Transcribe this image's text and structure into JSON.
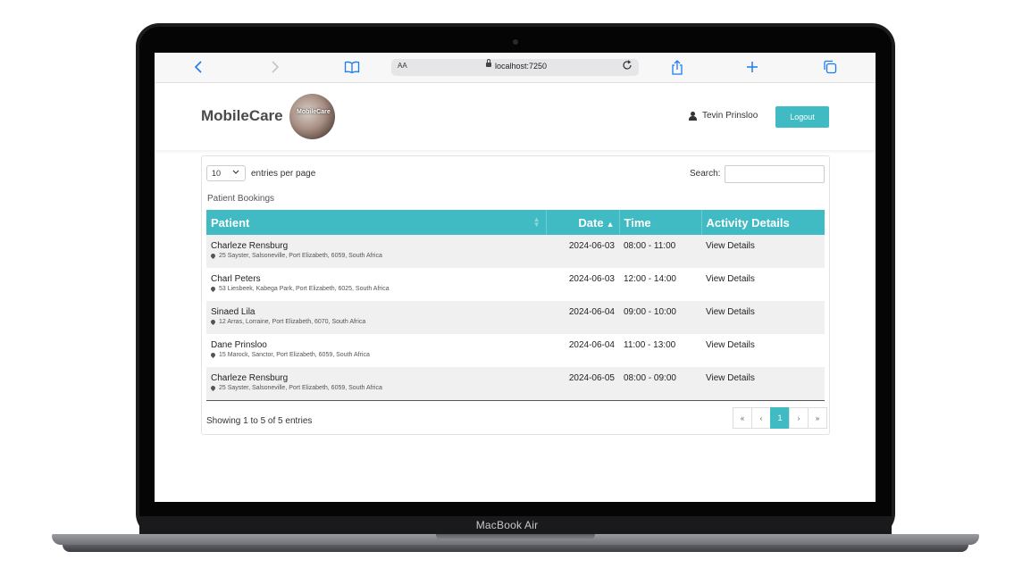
{
  "device": {
    "model_label": "MacBook Air"
  },
  "browser": {
    "url_text": "localhost:7250",
    "aa_label": "AA",
    "icons": {
      "back": "chevron-left-icon",
      "forward": "chevron-right-icon",
      "bookmarks": "book-icon",
      "reload": "reload-icon",
      "share": "share-icon",
      "new_tab": "plus-icon",
      "tabs": "tabs-icon"
    }
  },
  "header": {
    "brand": "MobileCare",
    "logo_text": "MobileCare",
    "user_name": "Tevin Prinsloo",
    "logout_label": "Logout"
  },
  "table_controls": {
    "page_length": "10",
    "entries_label": "entries per page",
    "search_label": "Search:",
    "search_value": "",
    "caption": "Patient Bookings"
  },
  "columns": [
    "Patient",
    "Date",
    "Time",
    "Activity Details"
  ],
  "rows": [
    {
      "name": "Charleze Rensburg",
      "address": "25 Sayster, Salsoneville, Port Elizabeth, 6059, South Africa",
      "date": "2024-06-03",
      "time": "08:00 - 11:00",
      "details": "View Details"
    },
    {
      "name": "Charl Peters",
      "address": "53 Liesbeek, Kabega Park, Port Elizabeth, 6025, South Africa",
      "date": "2024-06-03",
      "time": "12:00 - 14:00",
      "details": "View Details"
    },
    {
      "name": "Sinaed Lila",
      "address": "12 Arras, Lorraine, Port Elizabeth, 6070, South Africa",
      "date": "2024-06-04",
      "time": "09:00 - 10:00",
      "details": "View Details"
    },
    {
      "name": "Dane Prinsloo",
      "address": "15 Marock, Sanctor, Port Elizabeth, 6059, South Africa",
      "date": "2024-06-04",
      "time": "11:00 - 13:00",
      "details": "View Details"
    },
    {
      "name": "Charleze Rensburg",
      "address": "25 Sayster, Salsoneville, Port Elizabeth, 6059, South Africa",
      "date": "2024-06-05",
      "time": "08:00 - 09:00",
      "details": "View Details"
    }
  ],
  "footer": {
    "info": "Showing 1 to 5 of 5 entries",
    "pager": {
      "first": "«",
      "prev": "‹",
      "current": "1",
      "next": "›",
      "last": "»"
    }
  },
  "colors": {
    "accent": "#40bac3",
    "text": "#222222",
    "row_stripe": "#f0f0f0"
  }
}
